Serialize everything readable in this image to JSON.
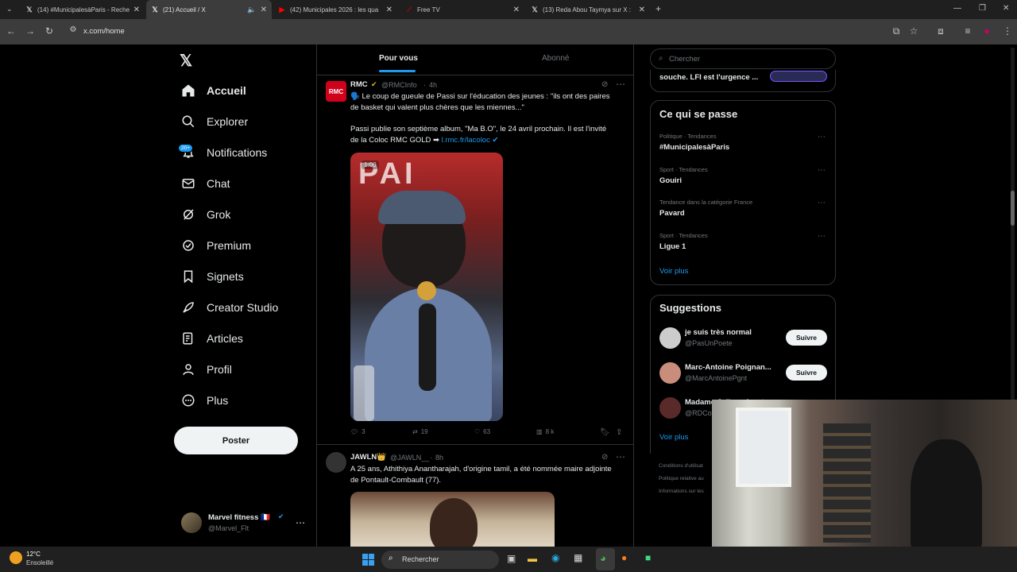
{
  "browser": {
    "tabs": [
      {
        "label": "(14) #MunicipalesàParis - Reche",
        "icon": "x-logo-icon"
      },
      {
        "label": "(21) Accueil / X",
        "icon": "x-logo-icon",
        "active": true
      },
      {
        "label": "(42) Municipales 2026 : les qua",
        "icon": "youtube-icon"
      },
      {
        "label": "Free TV",
        "icon": "freetv-icon"
      },
      {
        "label": "(13) Reda Abou Taymya sur X :",
        "icon": "x-logo-icon"
      }
    ],
    "url": "x.com/home"
  },
  "nav": {
    "items": [
      {
        "label": "Accueil",
        "icon": "home-icon"
      },
      {
        "label": "Explorer",
        "icon": "search-icon"
      },
      {
        "label": "Notifications",
        "icon": "bell-icon"
      },
      {
        "label": "Chat",
        "icon": "mail-icon"
      },
      {
        "label": "Grok",
        "icon": "grok-icon"
      },
      {
        "label": "Premium",
        "icon": "verified-icon"
      },
      {
        "label": "Signets",
        "icon": "bookmark-icon"
      },
      {
        "label": "Creator Studio",
        "icon": "rocket-icon"
      },
      {
        "label": "Articles",
        "icon": "article-icon"
      },
      {
        "label": "Profil",
        "icon": "person-icon"
      },
      {
        "label": "Plus",
        "icon": "more-circle-icon"
      }
    ],
    "notif_badge": "20+",
    "post_button": "Poster",
    "account": {
      "name": "Marvel fitness 🇫🇷",
      "handle": "@Marvel_Flt"
    }
  },
  "feed": {
    "tabs": [
      "Pour vous",
      "Abonné"
    ],
    "posts": [
      {
        "author": "RMC",
        "handle": "@RMCInfo",
        "time": "4h",
        "text1": "🗣️ Le coup de gueule de Passi sur l'éducation des jeunes : \"ils ont des paires de basket qui valent plus chères que les miennes...\"",
        "text2a": "Passi publie son septième album, \"Ma B.O\", le 24 avril prochain. Il est l'invité de la Coloc RMC GOLD ➡ ",
        "link": "l.rmc.fr/lacoloc",
        "video_time": "1:00",
        "replies": "3",
        "reposts": "19",
        "likes": "63",
        "views": "8 k"
      },
      {
        "author": "JAWLN👑",
        "handle": "@JAWLN__",
        "time": "8h",
        "text": "A 25 ans, Athithiya Anantharajah, d'origine tamil, a été nommée maire adjointe  de Pontault-Combault (77)."
      }
    ]
  },
  "sidebar": {
    "search_placeholder": "Chercher",
    "top_snippet": "souche. LFI est l'urgence ...",
    "trends_title": "Ce qui se passe",
    "trends": [
      {
        "category": "Politique · Tendances",
        "name": "#MunicipalesàParis"
      },
      {
        "category": "Sport · Tendances",
        "name": "Gouiri"
      },
      {
        "category": "Tendance dans la catégorie France",
        "name": "Pavard"
      },
      {
        "category": "Sport · Tendances",
        "name": "Ligue 1"
      }
    ],
    "show_more": "Voir plus",
    "suggestions_title": "Suggestions",
    "suggestions": [
      {
        "name": "je suis très normal",
        "handle": "@PasUnPoete",
        "button": "Suivre"
      },
      {
        "name": "Marc-Antoine Poignan...",
        "handle": "@MarcAntoinePgnt",
        "button": "Suivre"
      },
      {
        "name": "Madame Juliane Amet...",
        "handle": "@RDCo"
      }
    ],
    "show_more2": "Voir plus",
    "footer1": "Conditions d'utilisat",
    "footer2": "Politique relative au",
    "footer3": "Informations sur les"
  },
  "taskbar": {
    "temp": "12°C",
    "weather": "Ensoleillé",
    "search": "Rechercher"
  },
  "colors": {
    "accent": "#1d9bf0",
    "verified_gold": "#e2b719"
  }
}
